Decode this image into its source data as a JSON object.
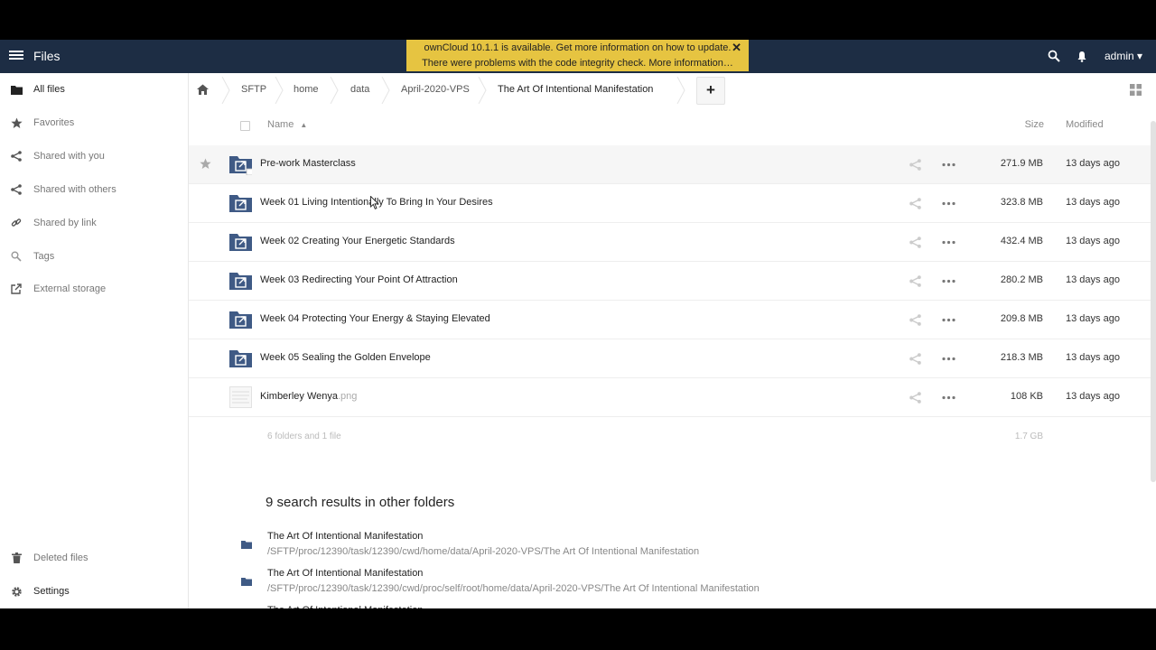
{
  "header": {
    "app_title": "Files",
    "notice_line1": "ownCloud 10.1.1 is available. Get more information on how to update.",
    "notice_line2": "There were problems with the code integrity check. More information…",
    "notice_close": "✕",
    "user": "admin"
  },
  "sidebar": {
    "items": [
      {
        "label": "All files",
        "icon": "folder-icon"
      },
      {
        "label": "Favorites",
        "icon": "star-icon"
      },
      {
        "label": "Shared with you",
        "icon": "share-icon"
      },
      {
        "label": "Shared with others",
        "icon": "share-icon"
      },
      {
        "label": "Shared by link",
        "icon": "link-icon"
      },
      {
        "label": "Tags",
        "icon": "tag-search-icon"
      },
      {
        "label": "External storage",
        "icon": "external-link-icon"
      }
    ],
    "deleted_files": "Deleted files",
    "settings": "Settings"
  },
  "breadcrumb": {
    "items": [
      "SFTP",
      "home",
      "data",
      "April-2020-VPS",
      "The Art Of Intentional Manifestation"
    ],
    "new_label": "+"
  },
  "table": {
    "col_name": "Name",
    "col_size": "Size",
    "col_modified": "Modified",
    "rows": [
      {
        "name": "Pre-work Masterclass",
        "ext": "",
        "size": "271.9 MB",
        "modified": "13 days ago",
        "type": "folder-link"
      },
      {
        "name": "Week 01 Living Intentionally To Bring In Your Desires",
        "ext": "",
        "size": "323.8 MB",
        "modified": "13 days ago",
        "type": "folder-link"
      },
      {
        "name": "Week 02 Creating Your Energetic Standards",
        "ext": "",
        "size": "432.4 MB",
        "modified": "13 days ago",
        "type": "folder-link"
      },
      {
        "name": "Week 03 Redirecting Your Point Of Attraction",
        "ext": "",
        "size": "280.2 MB",
        "modified": "13 days ago",
        "type": "folder-link"
      },
      {
        "name": "Week 04 Protecting Your Energy & Staying Elevated",
        "ext": "",
        "size": "209.8 MB",
        "modified": "13 days ago",
        "type": "folder-link"
      },
      {
        "name": "Week 05 Sealing the Golden Envelope",
        "ext": "",
        "size": "218.3 MB",
        "modified": "13 days ago",
        "type": "folder-link"
      },
      {
        "name": "Kimberley Wenya",
        "ext": ".png",
        "size": "108 KB",
        "modified": "13 days ago",
        "type": "image"
      }
    ],
    "summary_count": "6 folders and 1 file",
    "summary_total": "1.7 GB"
  },
  "search": {
    "title": "9 search results in other folders",
    "results": [
      {
        "name": "The Art Of Intentional Manifestation",
        "path": "/SFTP/proc/12390/task/12390/cwd/home/data/April-2020-VPS/The Art Of Intentional Manifestation"
      },
      {
        "name": "The Art Of Intentional Manifestation",
        "path": "/SFTP/proc/12390/task/12390/cwd/proc/self/root/home/data/April-2020-VPS/The Art Of Intentional Manifestation"
      },
      {
        "name": "The Art Of Intentional Manifestation",
        "path": ""
      }
    ]
  },
  "colors": {
    "header_bg": "#1d2d44",
    "notice_bg": "#e6c441",
    "folder_blue": "#3f5a85"
  }
}
